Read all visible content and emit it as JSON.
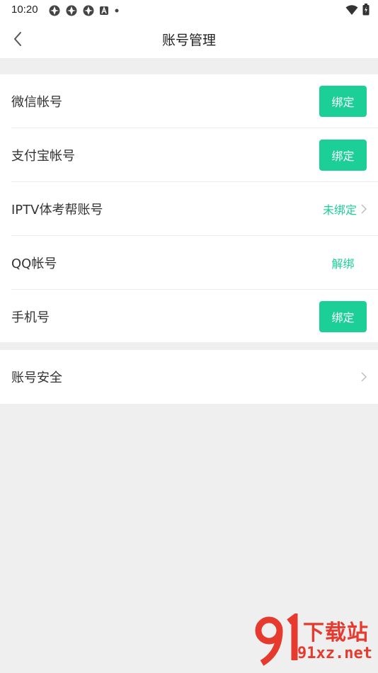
{
  "status_bar": {
    "time": "10:20"
  },
  "header": {
    "title": "账号管理"
  },
  "accounts": [
    {
      "label": "微信帐号",
      "action": "绑定"
    },
    {
      "label": "支付宝帐号",
      "action": "绑定"
    },
    {
      "label": "IPTV体考帮账号",
      "action": "未绑定"
    },
    {
      "label": "QQ帐号",
      "action": "解绑"
    },
    {
      "label": "手机号",
      "action": "绑定"
    }
  ],
  "security": {
    "label": "账号安全"
  },
  "watermark": {
    "brand": "下载站",
    "url": "91xz.net"
  },
  "colors": {
    "accent": "#1ccf97",
    "background": "#efefef",
    "watermark": "#e63a2f"
  }
}
